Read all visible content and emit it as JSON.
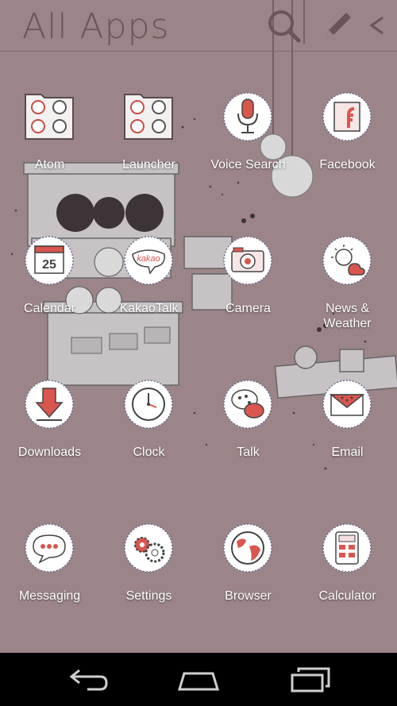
{
  "header": {
    "title": "All Apps",
    "search_icon": "search-icon",
    "edit_icon": "pencil-icon",
    "back_icon": "chevron-left-icon"
  },
  "colors": {
    "wallpaper": "#9b8588",
    "header_text": "#6a5659",
    "label_text": "#ffffff",
    "icon_red": "#d9564e",
    "navbar": "#000000"
  },
  "apps": [
    {
      "label": "Atom",
      "icon": "folder-icon"
    },
    {
      "label": "Launcher",
      "icon": "folder-icon"
    },
    {
      "label": "Voice Search",
      "icon": "microphone-icon"
    },
    {
      "label": "Facebook",
      "icon": "facebook-icon"
    },
    {
      "label": "Calendar",
      "icon": "calendar-icon",
      "badge": "25"
    },
    {
      "label": "KakaoTalk",
      "icon": "kakao-icon",
      "badge": "kakao"
    },
    {
      "label": "Camera",
      "icon": "camera-icon"
    },
    {
      "label": "News &\nWeather",
      "icon": "weather-icon"
    },
    {
      "label": "Downloads",
      "icon": "download-arrow-icon"
    },
    {
      "label": "Clock",
      "icon": "clock-icon"
    },
    {
      "label": "Talk",
      "icon": "speech-bubbles-icon"
    },
    {
      "label": "Email",
      "icon": "envelope-icon"
    },
    {
      "label": "Messaging",
      "icon": "message-bubble-icon"
    },
    {
      "label": "Settings",
      "icon": "gears-icon"
    },
    {
      "label": "Browser",
      "icon": "globe-icon"
    },
    {
      "label": "Calculator",
      "icon": "calculator-icon"
    }
  ],
  "navbar": {
    "back_icon": "back-arrow-icon",
    "home_icon": "home-icon",
    "recents_icon": "recent-apps-icon"
  }
}
